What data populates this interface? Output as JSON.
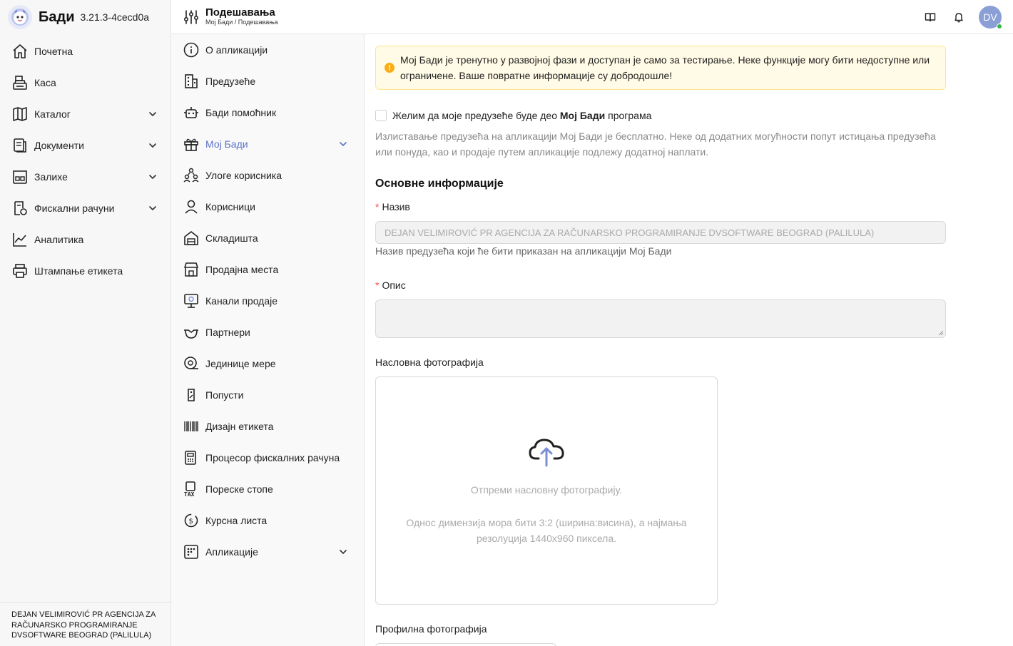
{
  "app": {
    "name": "Бади",
    "version": "3.21.3-4cecd0a"
  },
  "sidebar": {
    "items": [
      {
        "label": "Почетна",
        "icon": "home-icon",
        "chevron": false
      },
      {
        "label": "Каса",
        "icon": "cash-register-icon",
        "chevron": false
      },
      {
        "label": "Каталог",
        "icon": "catalog-icon",
        "chevron": true
      },
      {
        "label": "Документи",
        "icon": "documents-icon",
        "chevron": true
      },
      {
        "label": "Залихе",
        "icon": "warehouse-stock-icon",
        "chevron": true
      },
      {
        "label": "Фискални рачуни",
        "icon": "fiscal-receipt-icon",
        "chevron": true
      },
      {
        "label": "Аналитика",
        "icon": "analytics-chart-icon",
        "chevron": false
      },
      {
        "label": "Штампање етикета",
        "icon": "printer-icon",
        "chevron": false
      }
    ],
    "company": "DEJAN VELIMIROVIĆ PR AGENCIJA ZA RAČUNARSKO PROGRAMIRANJE DVSOFTWARE BEOGRAD (PALILULA)"
  },
  "header": {
    "title": "Подешавања",
    "breadcrumb": "Мој Бади / Подешавања",
    "avatar_initials": "DV"
  },
  "settings_menu": {
    "items": [
      {
        "label": "О апликацији",
        "icon": "info-icon",
        "chevron": false,
        "active": false
      },
      {
        "label": "Предузеће",
        "icon": "company-building-icon",
        "chevron": false,
        "active": false
      },
      {
        "label": "Бади помоћник",
        "icon": "robot-assistant-icon",
        "chevron": false,
        "active": false
      },
      {
        "label": "Мој Бади",
        "icon": "gift-icon",
        "chevron": true,
        "active": true
      },
      {
        "label": "Улоге корисника",
        "icon": "user-roles-icon",
        "chevron": false,
        "active": false
      },
      {
        "label": "Корисници",
        "icon": "user-icon",
        "chevron": false,
        "active": false
      },
      {
        "label": "Складишта",
        "icon": "storage-icon",
        "chevron": false,
        "active": false
      },
      {
        "label": "Продајна места",
        "icon": "store-icon",
        "chevron": false,
        "active": false
      },
      {
        "label": "Канали продаје",
        "icon": "sales-channel-icon",
        "chevron": false,
        "active": false
      },
      {
        "label": "Партнери",
        "icon": "partners-handshake-icon",
        "chevron": false,
        "active": false
      },
      {
        "label": "Јединице мере",
        "icon": "measure-tape-icon",
        "chevron": false,
        "active": false
      },
      {
        "label": "Попусти",
        "icon": "discount-tag-icon",
        "chevron": false,
        "active": false
      },
      {
        "label": "Дизајн етикета",
        "icon": "barcode-icon",
        "chevron": false,
        "active": false
      },
      {
        "label": "Процесор фискалних рачуна",
        "icon": "fiscal-processor-icon",
        "chevron": false,
        "active": false
      },
      {
        "label": "Пореске стопе",
        "icon": "tax-icon",
        "chevron": false,
        "active": false
      },
      {
        "label": "Курсна листа",
        "icon": "currency-exchange-icon",
        "chevron": false,
        "active": false
      },
      {
        "label": "Апликације",
        "icon": "apps-grid-icon",
        "chevron": true,
        "active": false
      }
    ]
  },
  "main": {
    "alert": "Мој Бади је тренутно у развојној фази и доступан је само за тестирање. Неке функције могу бити недоступне или ограничене. Ваше повратне информације су добродошле!",
    "checkbox": {
      "pre": "Желим да моје предузеће буде део ",
      "bold": "Мој Бади",
      "post": " програма",
      "checked": false
    },
    "checkbox_help": "Излиставање предузећа на апликацији Мој Бади је бесплатно. Неке од додатних могућности попут истицања предузећа или понуда, као и продаје путем апликације подлежу додатној наплати.",
    "section_title": "Основне информације",
    "name_label": "Назив",
    "name_value": "DEJAN VELIMIROVIĆ PR AGENCIJA ZA RAČUNARSKO PROGRAMIRANJE DVSOFTWARE BEOGRAD (PALILULA)",
    "name_help": "Назив предузећа који ће бити приказан на апликацији Мој Бади",
    "description_label": "Опис",
    "description_value": "",
    "cover_label": "Насловна фотографија",
    "cover_upload_text": "Отпреми насловну фотографију.",
    "cover_upload_hint": "Однос димензија мора бити 3:2 (ширина:висина), а најмања резолуција 1440x960 пиксела.",
    "profile_label": "Профилна фотографија"
  },
  "colors": {
    "accent": "#5b72c8",
    "warning": "#faad14",
    "alert_bg": "#fffbe6",
    "required": "#ff4d4f",
    "online": "#3bb54a"
  }
}
